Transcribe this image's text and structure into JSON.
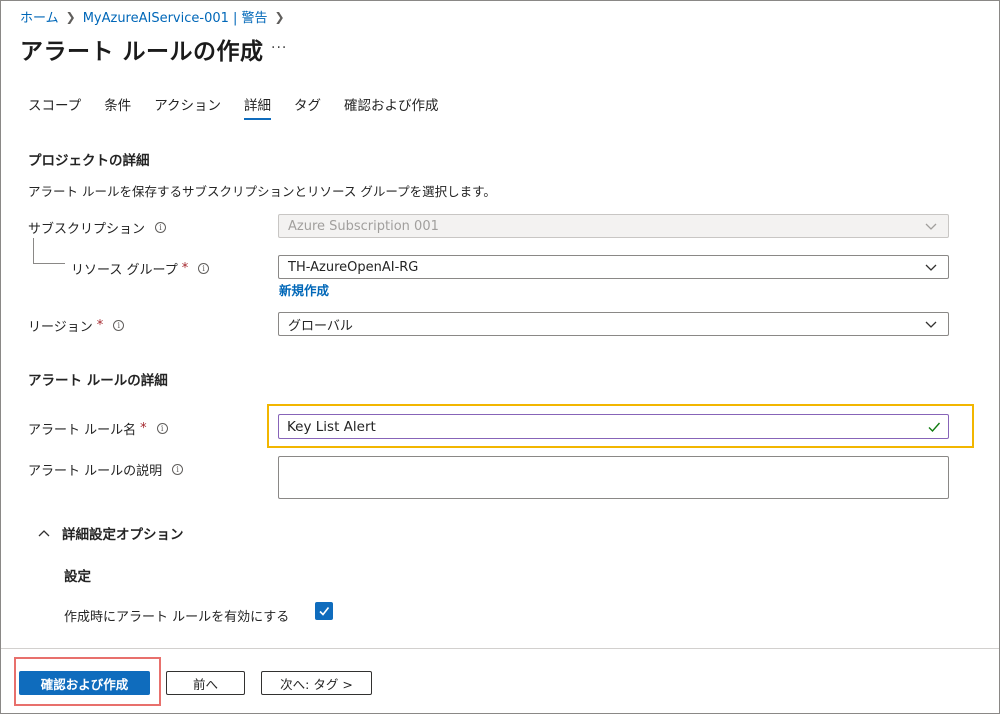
{
  "breadcrumb": {
    "home": "ホーム",
    "resource": "MyAzureAIService-001 | 警告"
  },
  "page": {
    "title": "アラート ルールの作成",
    "more": "···"
  },
  "tabs": [
    {
      "label": "スコープ"
    },
    {
      "label": "条件"
    },
    {
      "label": "アクション"
    },
    {
      "label": "詳細",
      "active": true
    },
    {
      "label": "タグ"
    },
    {
      "label": "確認および作成"
    }
  ],
  "project": {
    "heading": "プロジェクトの詳細",
    "description": "アラート ルールを保存するサブスクリプションとリソース グループを選択します。",
    "subscription_label": "サブスクリプション",
    "subscription_value": "Azure Subscription 001",
    "resource_group_label": "リソース グループ",
    "resource_group_value": "TH-AzureOpenAI-RG",
    "create_new": "新規作成",
    "region_label": "リージョン",
    "region_value": "グローバル"
  },
  "rule": {
    "heading": "アラート ルールの詳細",
    "name_label": "アラート ルール名",
    "name_value": "Key List Alert",
    "description_label": "アラート ルールの説明",
    "description_value": ""
  },
  "advanced": {
    "toggle_label": "詳細設定オプション",
    "settings_heading": "設定",
    "enable_label": "作成時にアラート ルールを有効にする",
    "enable_checked": true
  },
  "footer": {
    "primary": "確認および作成",
    "prev": "前へ",
    "next": "次へ: タグ >"
  },
  "colors": {
    "accent": "#0f6cbd",
    "highlight": "#f2b600",
    "callout": "#e8706c",
    "required": "#a4262c"
  },
  "required_mark": "*",
  "info_glyph": "i"
}
